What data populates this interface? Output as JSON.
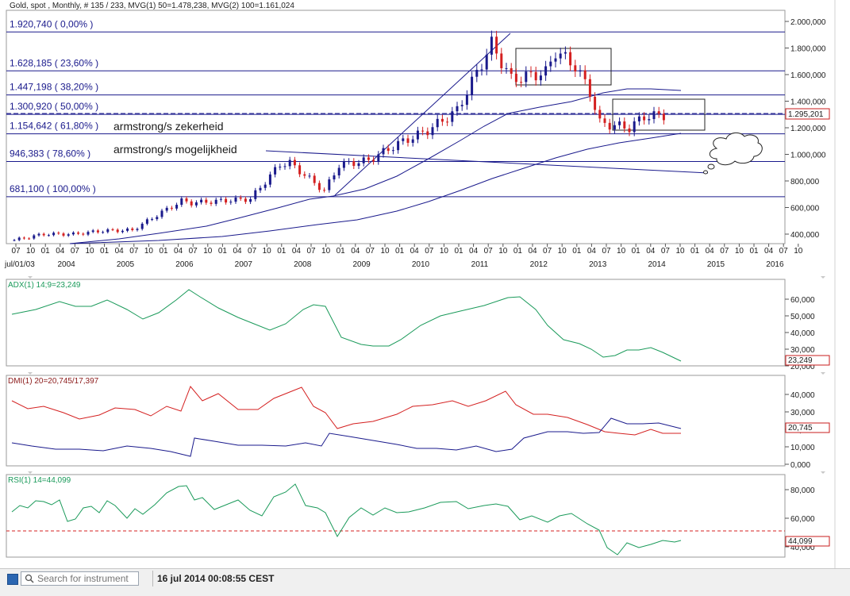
{
  "header": {
    "title": "Gold, spot , Monthly, # 135 / 233, MVG(1) 50=1.478,238, MVG(2) 100=1.161,024"
  },
  "price_axis": {
    "labels": [
      "2.000,000",
      "1.800,000",
      "1.600,000",
      "1.400,000",
      "1.200,000",
      "1.000,000",
      "800,000",
      "600,000",
      "400,000"
    ],
    "last_price_box": "1.295,201"
  },
  "fib_levels": [
    {
      "label": "1.920,740 ( 0,00% )",
      "value": 1920.74
    },
    {
      "label": "1.628,185 ( 23,60% )",
      "value": 1628.185
    },
    {
      "label": "1.447,198 ( 38,20% )",
      "value": 1447.198
    },
    {
      "label": "1.300,920 ( 50,00% )",
      "value": 1300.92
    },
    {
      "label": "1.154,642 ( 61,80% )",
      "value": 1154.642
    },
    {
      "label": "946,383 ( 78,60% )",
      "value": 946.383
    },
    {
      "label": "681,100 ( 100,00% )",
      "value": 681.1
    }
  ],
  "annotations": {
    "zekerheid": "armstrong/s zekerheid",
    "mogelijkheid": "armstrong/s mogelijkheid"
  },
  "time_axis": {
    "start_label": "jul/01/03",
    "months": [
      "07",
      "10",
      "01",
      "04",
      "07",
      "10",
      "01",
      "04",
      "07",
      "10",
      "01",
      "04",
      "07",
      "10",
      "01",
      "04",
      "07",
      "10",
      "01",
      "04",
      "07",
      "10",
      "01",
      "04",
      "07",
      "10",
      "01",
      "04",
      "07",
      "10",
      "01",
      "04",
      "07",
      "10",
      "01",
      "04",
      "07",
      "10",
      "01",
      "04",
      "07",
      "10",
      "01",
      "04",
      "07",
      "10",
      "01",
      "04",
      "07",
      "10",
      "01",
      "04",
      "07",
      "10"
    ],
    "years": [
      "2004",
      "2005",
      "2006",
      "2007",
      "2008",
      "2009",
      "2010",
      "2011",
      "2012",
      "2013",
      "2014",
      "2015",
      "2016"
    ]
  },
  "adx_panel": {
    "title": "ADX(1) 14;9=23,249",
    "axis": [
      "60,000",
      "50,000",
      "40,000",
      "30,000",
      "20,000"
    ],
    "value_box": "23,249",
    "color": "#1a9a5a"
  },
  "dmi_panel": {
    "title": "DMI(1) 20=20,745/17,397",
    "axis": [
      "40,000",
      "30,000",
      "20,000",
      "10,000",
      "0,000"
    ],
    "value_box": "20,745",
    "plus_color": "#1a1a8c",
    "minus_color": "#d42020"
  },
  "rsi_panel": {
    "title": "RSI(1) 14=44,099",
    "axis": [
      "80,000",
      "60,000",
      "40,000"
    ],
    "value_box": "44,099",
    "color": "#1a9a5a"
  },
  "bottom_bar": {
    "search_placeholder": "Search for instrument",
    "datetime": "16 jul 2014 00:08:55 CEST"
  },
  "chart_data": {
    "type": "candlestick",
    "title": "Gold, spot , Monthly",
    "ylim": [
      300,
      2050
    ],
    "grid": false,
    "series": [
      {
        "name": "MVG(1) 50",
        "last": 1478.238
      },
      {
        "name": "MVG(2) 100",
        "last": 1161.024
      }
    ],
    "approx_monthly_closes": [
      {
        "period": "2003-07",
        "close": 355
      },
      {
        "period": "2004-01",
        "close": 400
      },
      {
        "period": "2004-07",
        "close": 400
      },
      {
        "period": "2005-01",
        "close": 425
      },
      {
        "period": "2005-07",
        "close": 430
      },
      {
        "period": "2006-01",
        "close": 565
      },
      {
        "period": "2006-05",
        "close": 650
      },
      {
        "period": "2006-07",
        "close": 635
      },
      {
        "period": "2007-01",
        "close": 650
      },
      {
        "period": "2007-07",
        "close": 665
      },
      {
        "period": "2008-01",
        "close": 925
      },
      {
        "period": "2008-03",
        "close": 935
      },
      {
        "period": "2008-10",
        "close": 725
      },
      {
        "period": "2009-01",
        "close": 920
      },
      {
        "period": "2009-07",
        "close": 955
      },
      {
        "period": "2010-01",
        "close": 1080
      },
      {
        "period": "2010-07",
        "close": 1180
      },
      {
        "period": "2011-01",
        "close": 1330
      },
      {
        "period": "2011-08",
        "close": 1830
      },
      {
        "period": "2011-12",
        "close": 1565
      },
      {
        "period": "2012-07",
        "close": 1615
      },
      {
        "period": "2012-09",
        "close": 1775
      },
      {
        "period": "2013-01",
        "close": 1665
      },
      {
        "period": "2013-04",
        "close": 1470
      },
      {
        "period": "2013-06",
        "close": 1235
      },
      {
        "period": "2013-12",
        "close": 1200
      },
      {
        "period": "2014-03",
        "close": 1285
      },
      {
        "period": "2014-07",
        "close": 1295
      }
    ]
  }
}
